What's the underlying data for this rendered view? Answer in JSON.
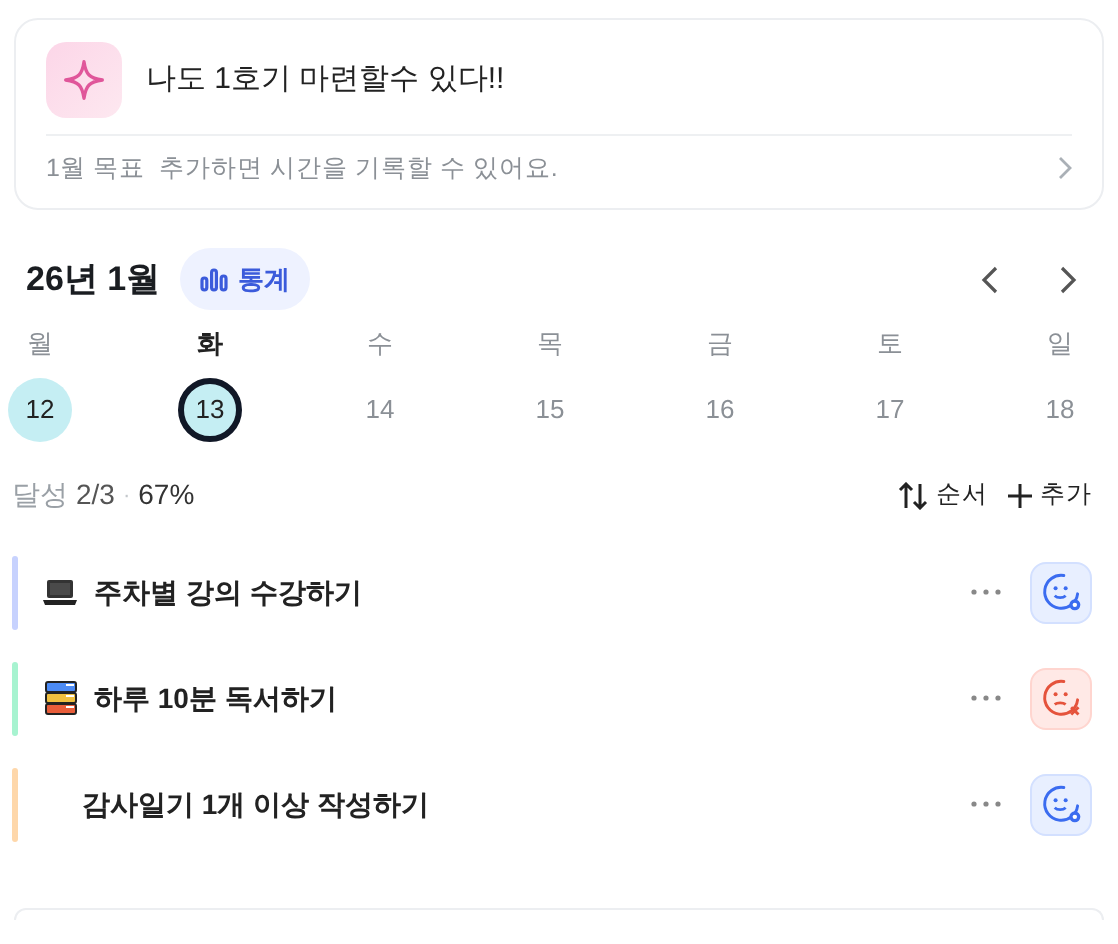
{
  "goal_card": {
    "title": "나도 1호기 마련할수 있다!!",
    "month_label": "1월 목표",
    "hint": "추가하면 시간을 기록할 수 있어요."
  },
  "calendar": {
    "month": "26년 1월",
    "stats_button": "통계",
    "days": [
      {
        "weekday": "월",
        "date": "12",
        "selected": false,
        "done": true
      },
      {
        "weekday": "화",
        "date": "13",
        "selected": true,
        "done": true
      },
      {
        "weekday": "수",
        "date": "14",
        "selected": false,
        "done": false
      },
      {
        "weekday": "목",
        "date": "15",
        "selected": false,
        "done": false
      },
      {
        "weekday": "금",
        "date": "16",
        "selected": false,
        "done": false
      },
      {
        "weekday": "토",
        "date": "17",
        "selected": false,
        "done": false
      },
      {
        "weekday": "일",
        "date": "18",
        "selected": false,
        "done": false
      }
    ]
  },
  "summary": {
    "label": "달성",
    "count": "2/3",
    "separator": "·",
    "percent": "67%",
    "sort_button": "순서",
    "add_button": "추가"
  },
  "tasks": [
    {
      "kind": "laptop",
      "title": "주차별 강의 수강하기",
      "color": "#c7d2fe",
      "done": true
    },
    {
      "kind": "books",
      "title": "하루 10분 독서하기",
      "color": "#a7f3d0",
      "done": false
    },
    {
      "kind": "plain",
      "title": "감사일기 1개 이상 작성하기",
      "color": "#fed7aa",
      "done": true
    }
  ]
}
